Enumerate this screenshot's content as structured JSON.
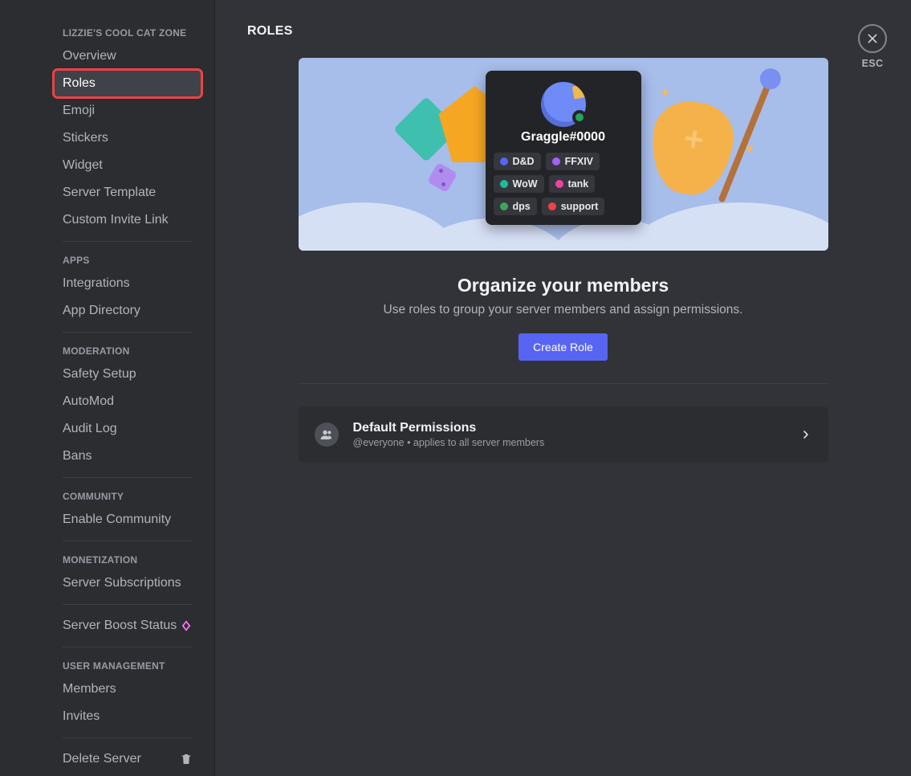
{
  "server_name_header": "LIZZIE'S COOL CAT ZONE",
  "sidebar": {
    "sections": [
      {
        "header": null,
        "items": [
          {
            "label": "Overview",
            "active": false
          },
          {
            "label": "Roles",
            "active": true,
            "highlighted": true
          },
          {
            "label": "Emoji",
            "active": false
          },
          {
            "label": "Stickers",
            "active": false
          },
          {
            "label": "Widget",
            "active": false
          },
          {
            "label": "Server Template",
            "active": false
          },
          {
            "label": "Custom Invite Link",
            "active": false
          }
        ]
      },
      {
        "header": "APPS",
        "items": [
          {
            "label": "Integrations"
          },
          {
            "label": "App Directory"
          }
        ]
      },
      {
        "header": "MODERATION",
        "items": [
          {
            "label": "Safety Setup"
          },
          {
            "label": "AutoMod"
          },
          {
            "label": "Audit Log"
          },
          {
            "label": "Bans"
          }
        ]
      },
      {
        "header": "COMMUNITY",
        "items": [
          {
            "label": "Enable Community"
          }
        ]
      },
      {
        "header": "MONETIZATION",
        "items": [
          {
            "label": "Server Subscriptions"
          }
        ]
      },
      {
        "header": null,
        "items": [
          {
            "label": "Server Boost Status",
            "boost_icon": true
          }
        ]
      },
      {
        "header": "USER MANAGEMENT",
        "items": [
          {
            "label": "Members"
          },
          {
            "label": "Invites"
          }
        ]
      },
      {
        "header": null,
        "items": [
          {
            "label": "Delete Server",
            "trash_icon": true
          }
        ]
      }
    ]
  },
  "page": {
    "title": "ROLES",
    "close_label": "ESC",
    "profile": {
      "username": "Graggle#0000",
      "status": "online",
      "roles": [
        {
          "label": "D&D",
          "color": "#5865f2"
        },
        {
          "label": "FFXIV",
          "color": "#a062f7"
        },
        {
          "label": "WoW",
          "color": "#1abc9c"
        },
        {
          "label": "tank",
          "color": "#eb459e"
        },
        {
          "label": "dps",
          "color": "#3ba55d"
        },
        {
          "label": "support",
          "color": "#ed4245"
        }
      ]
    },
    "promo": {
      "heading": "Organize your members",
      "sub": "Use roles to group your server members and assign permissions.",
      "button": "Create Role"
    },
    "default_perm": {
      "title": "Default Permissions",
      "sub": "@everyone • applies to all server members"
    }
  }
}
